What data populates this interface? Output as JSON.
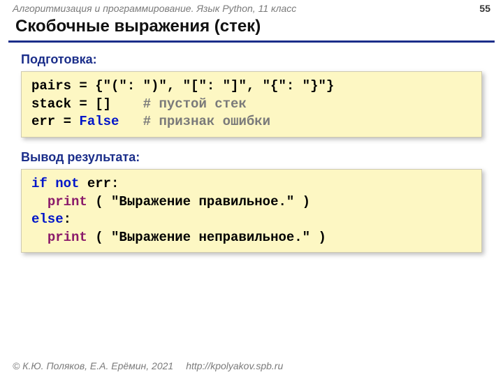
{
  "header": {
    "course": "Алгоритмизация и программирование. Язык Python, 11 класс",
    "page": "55"
  },
  "title": "Скобочные выражения (стек)",
  "sections": {
    "prep_label": "Подготовка:",
    "result_label": "Вывод результата:"
  },
  "code1": {
    "l1": "pairs = {\"(\": \")\", \"[\": \"]\", \"{\": \"}\"}",
    "l2a": "stack = []    ",
    "l2b": "# пустой стек",
    "l3a": "err = ",
    "l3b": "False",
    "l3c": "   ",
    "l3d": "# признак ошибки"
  },
  "code2": {
    "l1a": "if",
    "l1b": " ",
    "l1c": "not",
    "l1d": " err:",
    "l2a": "  ",
    "l2b": "print",
    "l2c": " ( \"Выражение правильное.\" )",
    "l3a": "else",
    "l3b": ":",
    "l4a": "  ",
    "l4b": "print",
    "l4c": " ( \"Выражение неправильное.\" )"
  },
  "footer": {
    "copyright": "© К.Ю. Поляков, Е.А. Ерёмин, 2021",
    "url": "http://kpolyakov.spb.ru"
  }
}
